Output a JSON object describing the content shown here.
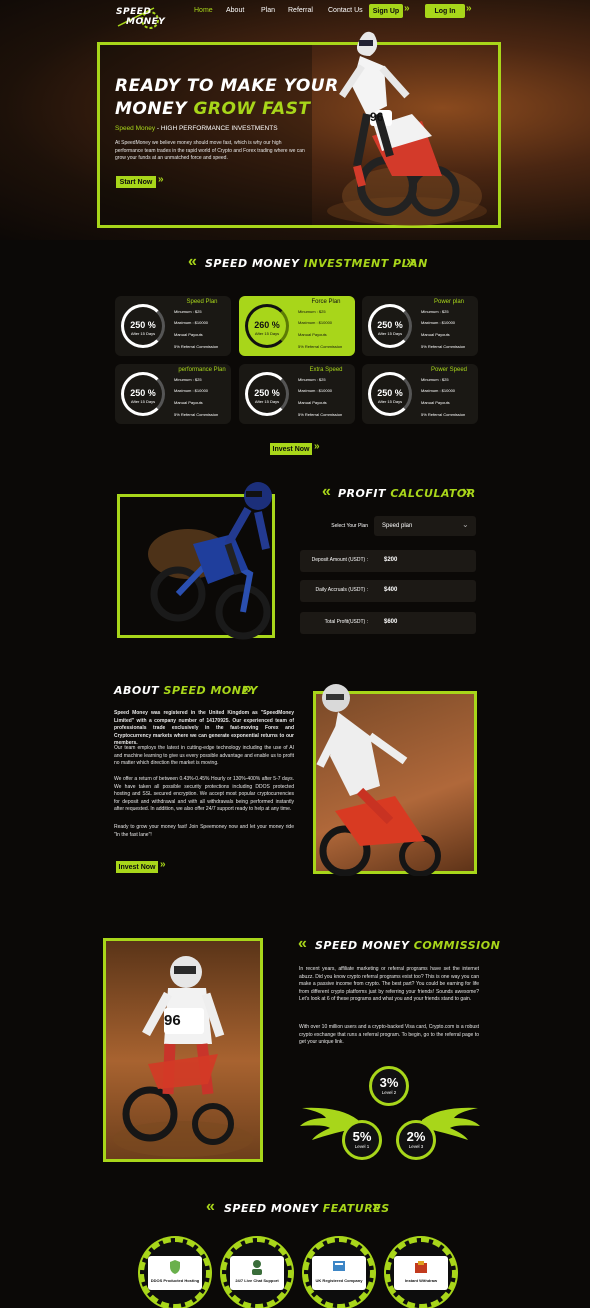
{
  "nav": {
    "logo_line1": "SPEED",
    "logo_line2": "MONEY",
    "items": [
      "Home",
      "About",
      "Plan",
      "Referral",
      "Contact Us"
    ],
    "signup": "Sign Up",
    "login": "Log In"
  },
  "hero": {
    "title_line1": "READY TO MAKE YOUR",
    "title_line2_a": "MONEY ",
    "title_line2_b": "GROW FAST",
    "tagline_a": "Speed Money",
    "tagline_b": " - HIGH PERFORMANCE INVESTMENTS",
    "desc": "At SpeedMoney we believe money should move fast, which is why our high performance team trades in the rapid world of Crypto and Forex trading where we can grow your funds at an unmatched force and speed.",
    "cta": "Start Now",
    "bib": "96"
  },
  "plans": {
    "title_a": "SPEED MONEY ",
    "title_b": "INVESTMENT PLAN",
    "cards": [
      {
        "name": "Speed Plan",
        "pct": "250 %",
        "days": "After 15 Days",
        "min": "Minumum : $25",
        "max": "Maximum : $10000",
        "payout": "Manual Payouts",
        "ref": "5% Referral Commission"
      },
      {
        "name": "Force Plan",
        "pct": "260 %",
        "days": "After 15 Days",
        "min": "Minumum : $25",
        "max": "Maximum : $10000",
        "payout": "Manual Payouts",
        "ref": "5% Referral Commission"
      },
      {
        "name": "Power plan",
        "pct": "250 %",
        "days": "After 15 Days",
        "min": "Minumum : $25",
        "max": "Maximum : $10000",
        "payout": "Manual Payouts",
        "ref": "5% Referral Commission"
      },
      {
        "name": "performance Plan",
        "pct": "250 %",
        "days": "After 15 Days",
        "min": "Minumum : $25",
        "max": "Maximum : $10000",
        "payout": "Manual Payouts",
        "ref": "5% Referral Commission"
      },
      {
        "name": "Extra Speed",
        "pct": "250 %",
        "days": "After 15 Days",
        "min": "Minumum : $25",
        "max": "Maximum : $10000",
        "payout": "Manual Payouts",
        "ref": "5% Referral Commission"
      },
      {
        "name": "Power Speed",
        "pct": "250 %",
        "days": "After 15 Days",
        "min": "Minumum : $25",
        "max": "Maximum : $10000",
        "payout": "Manual Payouts",
        "ref": "5% Referral Commission"
      }
    ],
    "invest": "Invest Now"
  },
  "calc": {
    "title_a": "PROFIT ",
    "title_b": "CALCULATOR",
    "select_label": "Select Your Plan",
    "select_value": "Speed plan",
    "rows": [
      {
        "label": "Deposit Amount (USDT) :",
        "value": "$200"
      },
      {
        "label": "Daily Accruals (USDT) :",
        "value": "$400"
      },
      {
        "label": "Total Profit(USDT) :",
        "value": "$600"
      }
    ]
  },
  "about": {
    "title_a": "ABOUT ",
    "title_b": "SPEED MONEY",
    "p1": "Speed Money was registered in the United Kingdom as \"SpeedMoney Limited\" with a company number of 14170925. Our experienced team of professionals trade exclusively in the fast-moving Forex and Cryptocurrency markets where we can generate exponential returns to our members.",
    "p2": "Our team employs the latest in cutting-edge technology including the use of AI and machine learning to give us every possible advantage and enable us to profit no matter which direction the market is moving.",
    "p3": "We offer a return of between 0.43%-0.45% Hourly or 130%-400% after 5-7 days. We have taken all possible security protections including DDOS protected hosting and SSL secured encryption. We accept most popular cryptocurrencies for deposit and withdrawal and with all withdrawals being performed instantly after requested. In addition, we also offer 24/7 support ready to help at any time.",
    "p4": "Ready to grow your money fast! Join Speemoney now and let your money ride \"In the fast lane\"!",
    "cta": "Invest Now"
  },
  "commission": {
    "title_a": "SPEED MONEY ",
    "title_b": "COMMISSION",
    "p1": "In recent years, affiliate marketing or referral programs have set the internet abuzz. Did you know crypto referral programs exist too? This is one way you can make a passive income from crypto. The best part? You could be earning for life from different crypto platforms just by referring your friends! Sounds awesome? Let's look at 6 of these programs and what you and your friends stand to gain.",
    "p2": "With over 10 million users and a crypto-backed Visa card, Crypto.com is a robust crypto exchange that runs a referral program. To begin, go to the referral page to get your unique link.",
    "levels": [
      {
        "value": "3%",
        "label": "Level 2"
      },
      {
        "value": "5%",
        "label": "Level 1"
      },
      {
        "value": "2%",
        "label": "Level 3"
      }
    ],
    "bib": "96"
  },
  "features": {
    "title_a": "SPEED MONEY ",
    "title_b": "FEATURES",
    "items": [
      {
        "label": "DDOS Producted Hosting",
        "icon": "shield-icon"
      },
      {
        "label": "24/7 Live Chat Support",
        "icon": "support-agent-icon"
      },
      {
        "label": "UK Registered Company",
        "icon": "certificate-icon"
      },
      {
        "label": "Instant Withdraw",
        "icon": "wallet-icon"
      }
    ]
  },
  "colors": {
    "accent": "#a8d61a",
    "background": "#0b0907"
  }
}
